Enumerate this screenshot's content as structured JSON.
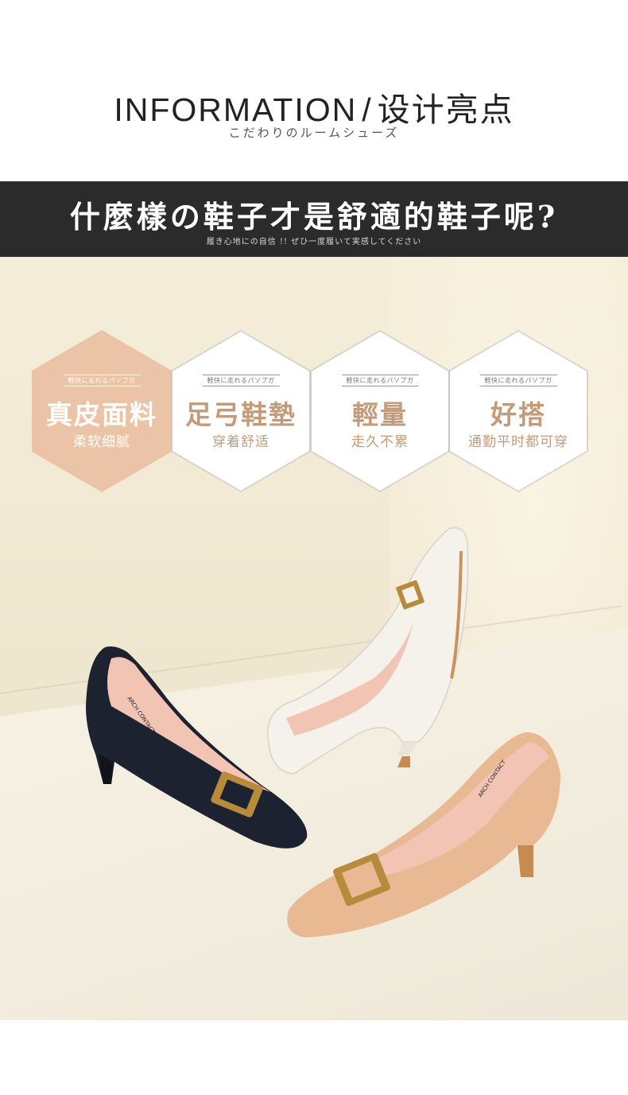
{
  "header": {
    "title_en": "INFORMATION",
    "title_sep": "/",
    "title_cn": "设计亮点",
    "subtitle": "こだわりのルームシューズ"
  },
  "banner": {
    "headline": "什麼樣の鞋子才是舒適的鞋子呢?",
    "subline": "履き心地にの自信 !! ぜひ一度履いて実感してください"
  },
  "features": [
    {
      "tag": "軽快に走れるパソプガ",
      "title": "真皮面料",
      "desc": "柔软细腻",
      "active": true
    },
    {
      "tag": "軽快に走れるパソプガ",
      "title": "足弓鞋墊",
      "desc": "穿着舒适",
      "active": false
    },
    {
      "tag": "軽快に走れるパソプガ",
      "title": "輕量",
      "desc": "走久不累",
      "active": false
    },
    {
      "tag": "軽快に走れるパソプガ",
      "title": "好搭",
      "desc": "通勤平时都可穿",
      "active": false
    }
  ],
  "photo": {
    "shoe_black_insole_brand": "ARCH CONTACT",
    "shoe_beige_insole_brand": "ARCH CONTACT",
    "colors": {
      "black": "#1d2230",
      "white": "#f5f2ec",
      "beige": "#e8b992",
      "lining": "#f2c4b4",
      "gold": "#b88a3c",
      "accent": "#c49a78"
    }
  }
}
